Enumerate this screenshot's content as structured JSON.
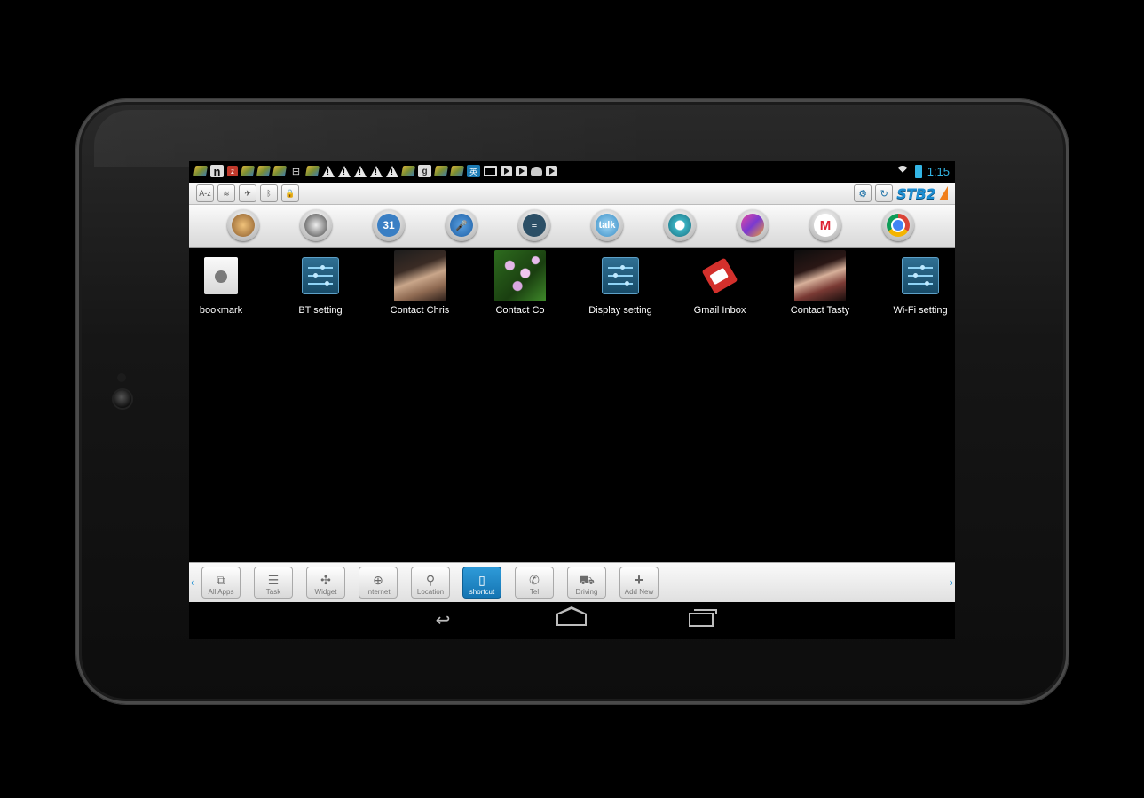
{
  "status_bar": {
    "notification_icons": [
      "book-icon",
      "n-icon",
      "red-app-icon",
      "book-icon",
      "book-icon",
      "book-icon",
      "wifi-box-icon",
      "book-icon",
      "warning-icon",
      "warning-icon",
      "warning-icon",
      "warning-icon",
      "warning-icon",
      "book-icon",
      "google-plus-icon",
      "book-icon",
      "book-icon",
      "chinese-char-icon",
      "gmail-icon",
      "play-store-icon",
      "play-store-icon",
      "android-icon",
      "play-store-icon"
    ],
    "time": "1:15",
    "accent_color": "#33b5e5"
  },
  "toolbar": {
    "left_buttons": [
      {
        "name": "az-button",
        "glyph": "A-z"
      },
      {
        "name": "wifi-toggle",
        "glyph": "≋"
      },
      {
        "name": "airplane-toggle",
        "glyph": "✈"
      },
      {
        "name": "bluetooth-toggle",
        "glyph": "ᛒ"
      },
      {
        "name": "lock-toggle",
        "glyph": "🔒"
      }
    ],
    "logo": "STB2"
  },
  "dock": {
    "apps": [
      "gallery-icon",
      "camera-icon",
      "calendar-icon",
      "voice-search-icon",
      "settings-icon",
      "talk-icon",
      "maps-icon",
      "photo-icon",
      "gmail-icon",
      "chrome-icon"
    ],
    "talk_label": "talk",
    "calendar_label": "31"
  },
  "home": {
    "shortcuts": [
      {
        "label": "bookmark",
        "icon": "bookmark-icon"
      },
      {
        "label": "BT setting",
        "icon": "settings-icon"
      },
      {
        "label": "Contact Chris",
        "icon": "contact-photo"
      },
      {
        "label": "Contact Co",
        "icon": "contact-photo"
      },
      {
        "label": "Display setting",
        "icon": "settings-icon"
      },
      {
        "label": "Gmail Inbox",
        "icon": "tag-icon"
      },
      {
        "label": "Contact Tasty",
        "icon": "contact-photo"
      },
      {
        "label": "Wi-Fi setting",
        "icon": "settings-icon"
      }
    ]
  },
  "tabbar": {
    "tabs": [
      {
        "label": "All Apps",
        "glyph": "⧉",
        "active": false
      },
      {
        "label": "Task",
        "glyph": "☰",
        "active": false
      },
      {
        "label": "Widget",
        "glyph": "✣",
        "active": false
      },
      {
        "label": "Internet",
        "glyph": "⊕",
        "active": false
      },
      {
        "label": "Location",
        "glyph": "⚲",
        "active": false
      },
      {
        "label": "shortcut",
        "glyph": "▯",
        "active": true
      },
      {
        "label": "Tel",
        "glyph": "✆",
        "active": false
      },
      {
        "label": "Driving",
        "glyph": "⛟",
        "active": false
      },
      {
        "label": "Add New",
        "glyph": "+",
        "active": false
      }
    ],
    "left_arrow": "‹",
    "right_arrow": "›",
    "active_color": "#1d8ed3"
  }
}
